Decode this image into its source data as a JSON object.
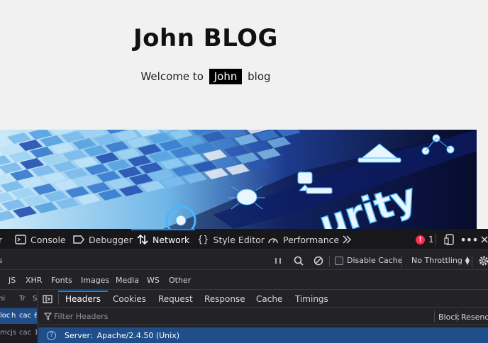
{
  "page": {
    "title": "John BLOG",
    "welcome_prefix": "Welcome to",
    "welcome_name": "John",
    "welcome_suffix": "blog",
    "banner_text": "urity"
  },
  "devtools": {
    "tabs": [
      {
        "label": "r",
        "icon": "inspector-icon"
      },
      {
        "label": "Console",
        "icon": "console-icon"
      },
      {
        "label": "Debugger",
        "icon": "debugger-icon"
      },
      {
        "label": "Network",
        "icon": "network-icon",
        "active": true
      },
      {
        "label": "Style Editor",
        "icon": "style-editor-icon"
      },
      {
        "label": "Performance",
        "icon": "performance-icon"
      }
    ],
    "error_count": "1",
    "toolbar": {
      "disable_cache_label": "Disable Cache",
      "throttling_label": "No Throttling",
      "left_fragment": "s"
    },
    "filters": [
      "JS",
      "XHR",
      "Fonts",
      "Images",
      "Media",
      "WS",
      "Other"
    ],
    "request_list": {
      "headers": [
        "hi",
        "Tr",
        "S"
      ],
      "rows": [
        {
          "cells": [
            "loc",
            "h",
            "cac",
            "6"
          ],
          "selected": true
        },
        {
          "cells": [
            "mc",
            "js",
            "cac",
            "1"
          ],
          "selected": false
        }
      ]
    },
    "detail_tabs": [
      "Headers",
      "Cookies",
      "Request",
      "Response",
      "Cache",
      "Timings"
    ],
    "filter_placeholder": "Filter Headers",
    "block_label": "Block",
    "resend_label": "Resend",
    "header_row": {
      "name": "Server:",
      "value": "Apache/2.4.50 (Unix)"
    }
  },
  "colors": {
    "accent": "#0a84ff",
    "selected_row": "#204e8a",
    "devtools_bg": "#232327",
    "error": "#ff2a50"
  }
}
